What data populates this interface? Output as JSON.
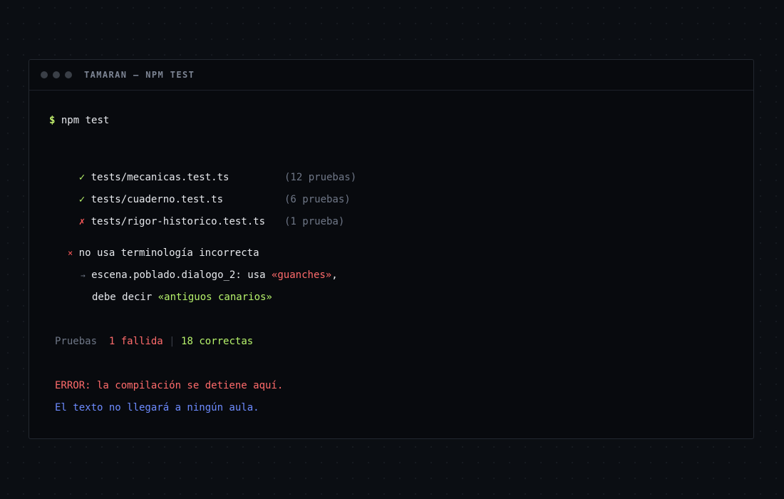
{
  "window": {
    "title": "TAMARAN — NPM TEST"
  },
  "command": {
    "prompt": "$",
    "text": "npm test"
  },
  "test_files": [
    {
      "status_icon": "✓",
      "path": "tests/mecanicas.test.ts",
      "count": "(12 pruebas)"
    },
    {
      "status_icon": "✓",
      "path": "tests/cuaderno.test.ts",
      "count": "(6 pruebas)"
    },
    {
      "status_icon": "✗",
      "path": "tests/rigor-historico.test.ts",
      "count": "(1 prueba)"
    }
  ],
  "failure": {
    "icon": "×",
    "name": "no usa terminología incorrecta",
    "arrow": "→",
    "detail_prefix": "escena.poblado.dialogo_2: usa ",
    "wrong_term": "«guanches»",
    "detail_comma": ",",
    "fix_prefix": "debe decir ",
    "right_term": "«antiguos canarios»"
  },
  "summary": {
    "label": "Pruebas",
    "failed": "1 fallida",
    "separator": "|",
    "passed": "18 correctas"
  },
  "messages": {
    "error": "ERROR: la compilación se detiene aquí.",
    "note": "El texto no llegará a ningún aula."
  },
  "colors": {
    "background": "#0b0e13",
    "pass": "#b6f26b",
    "fail": "#ff5a5a",
    "info": "#6d8bff",
    "muted": "#6f7787"
  }
}
